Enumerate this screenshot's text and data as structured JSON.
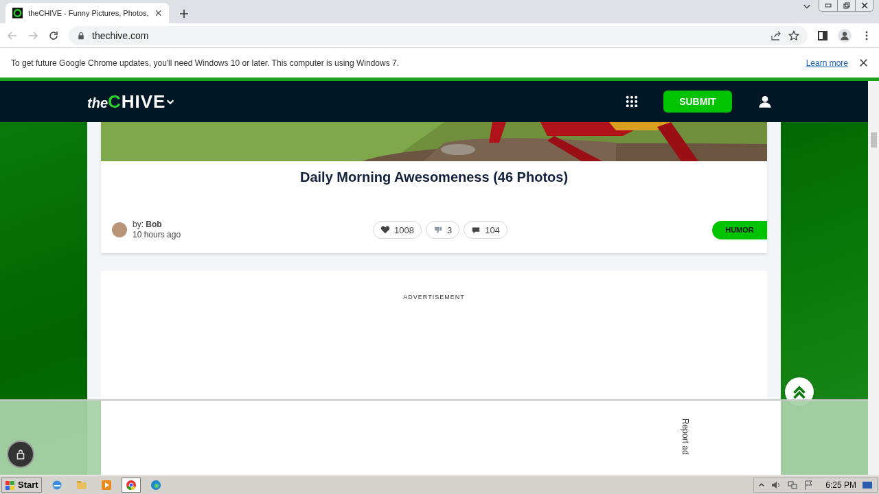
{
  "browser": {
    "tab": {
      "title": "theCHIVE - Funny Pictures, Photos, ",
      "selected": true
    },
    "url": "thechive.com",
    "infobar": {
      "message": "To get future Google Chrome updates, you'll need Windows 10 or later. This computer is using Windows 7.",
      "link": "Learn more"
    }
  },
  "site_header": {
    "logo_small": "the",
    "logo_big": "CHIVE",
    "submit": "SUBMIT"
  },
  "post": {
    "title": "Daily Morning Awesomeness (46 Photos)",
    "author_prefix": "by:",
    "author": "Bob",
    "time": "10 hours ago",
    "reactions": [
      {
        "kind": "like",
        "count": "1008"
      },
      {
        "kind": "dislike",
        "count": "3"
      },
      {
        "kind": "comment",
        "count": "104"
      }
    ],
    "category": "HUMOR"
  },
  "advertisement": {
    "label": "ADVERTISEMENT",
    "report": "Report ad"
  },
  "taskbar": {
    "start": "Start",
    "clock": "6:25 PM"
  }
}
